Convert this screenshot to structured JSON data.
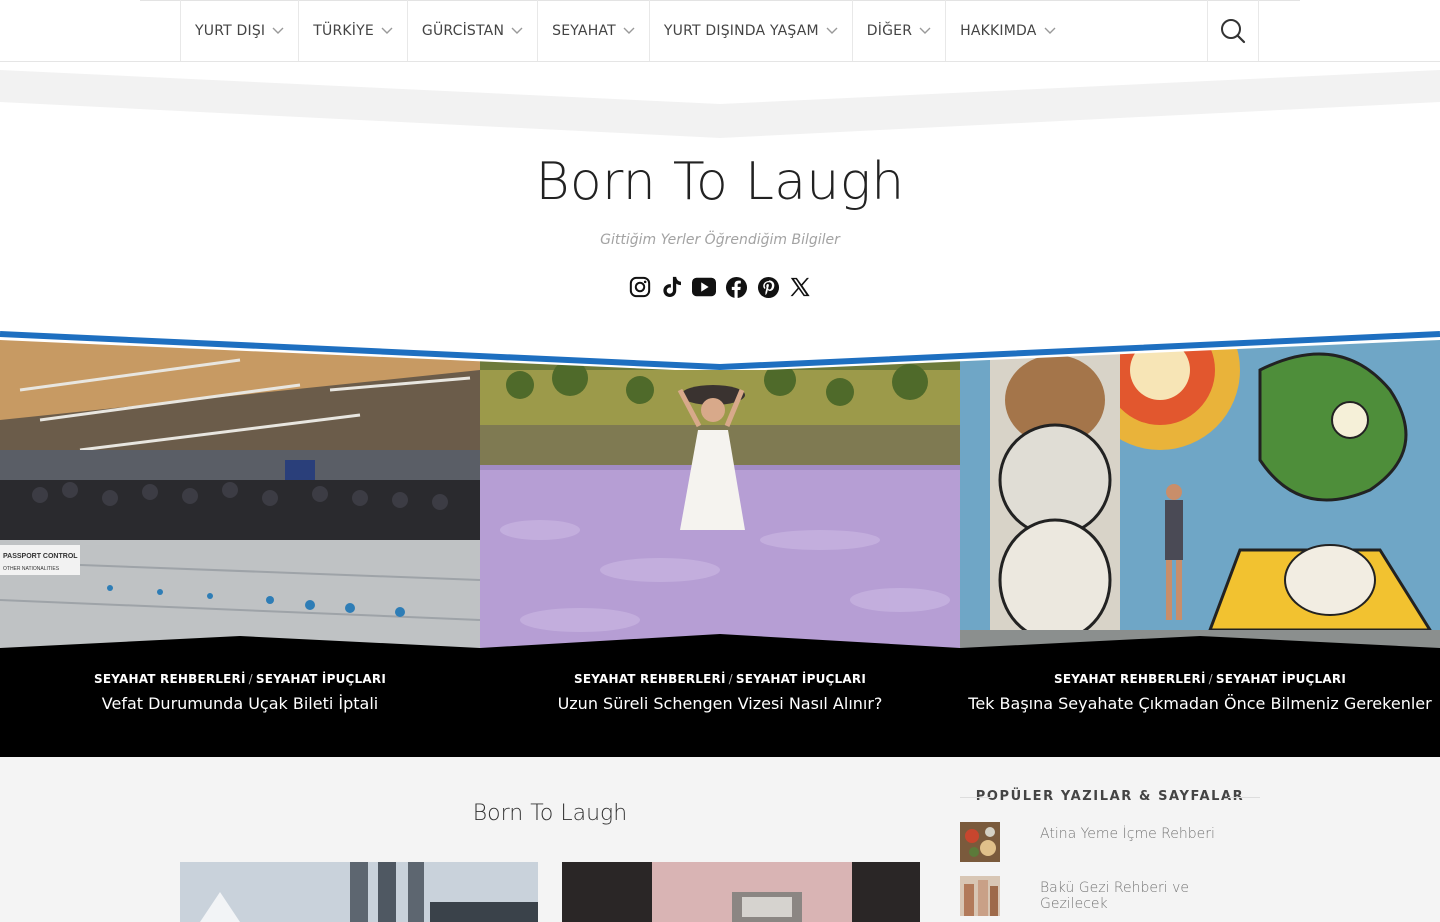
{
  "nav": {
    "items": [
      {
        "label": "YURT DIŞI"
      },
      {
        "label": "TÜRKİYE"
      },
      {
        "label": "GÜRCİSTAN"
      },
      {
        "label": "SEYAHAT"
      },
      {
        "label": "YURT DIŞINDA YAŞAM"
      },
      {
        "label": "DİĞER"
      },
      {
        "label": "HAKKIMDA"
      }
    ],
    "search_icon": "search-icon"
  },
  "header": {
    "title": "Born To Laugh",
    "tagline": "Gittiğim Yerler Öğrendiğim Bilgiler",
    "social": [
      "instagram-icon",
      "tiktok-icon",
      "youtube-icon",
      "facebook-icon",
      "pinterest-icon",
      "x-icon"
    ]
  },
  "featured": [
    {
      "cat1": "SEYAHAT REHBERLERİ",
      "sep": "/",
      "cat2": "SEYAHAT İPUÇLARI",
      "title": "Vefat Durumunda Uçak Bileti İptali",
      "sign1": "PASSPORT CONTROL",
      "sign2": "OTHER NATIONALITIES"
    },
    {
      "cat1": "SEYAHAT REHBERLERİ",
      "sep": "/",
      "cat2": "SEYAHAT İPUÇLARI",
      "title": "Uzun Süreli Schengen Vizesi Nasıl Alınır?"
    },
    {
      "cat1": "SEYAHAT REHBERLERİ",
      "sep": "/",
      "cat2": "SEYAHAT İPUÇLARI",
      "title": "Tek Başına Seyahate Çıkmadan Önce Bilmeniz Gerekenler"
    }
  ],
  "main": {
    "title": "Born To Laugh"
  },
  "sidebar": {
    "title": "POPÜLER YAZILAR & SAYFALAR",
    "items": [
      {
        "title": "Atina Yeme İçme Rehberi"
      },
      {
        "title": "Bakü Gezi Rehberi ve Gezilecek"
      }
    ]
  },
  "colors": {
    "accent_blue": "#1e6fc0",
    "band_gray": "#f2f2f2",
    "feature_bg": "#000000"
  }
}
